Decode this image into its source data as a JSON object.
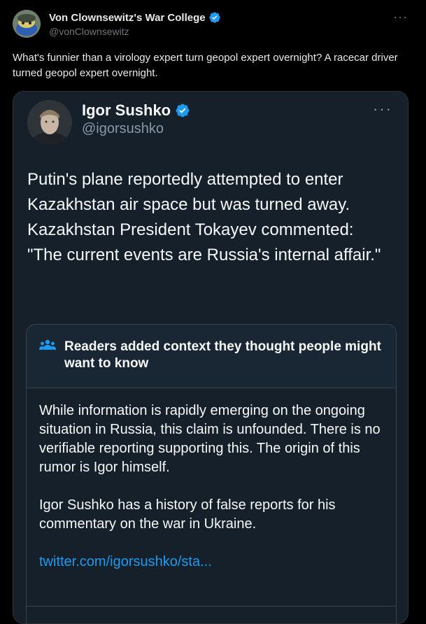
{
  "post": {
    "author_name": "Von Clownsewitz's War College",
    "author_handle": "@vonClownsewitz",
    "text": "What's funnier than a virology expert turn geopol expert overnight? A racecar driver turned geopol expert overnight.",
    "more_label": "···"
  },
  "quoted": {
    "author_name": "Igor Sushko",
    "author_handle": "@igorsushko",
    "more_label": "···",
    "text": "Putin's plane reportedly attempted to enter Kazakhstan air space but was turned away. Kazakhstan President Tokayev commented: \"The current events are Russia's internal affair.\"",
    "community_note": {
      "title": "Readers added context they thought people might want to know",
      "paragraph_1": "While information is rapidly emerging on the ongoing situation in Russia, this claim is unfounded. There is no verifiable reporting supporting this. The origin of this rumor is Igor himself.",
      "paragraph_2": "Igor Sushko has a history of false reports for his commentary on the war in Ukraine.",
      "link": "twitter.com/igorsushko/sta..."
    }
  },
  "colors": {
    "background": "#000000",
    "card": "#15202b",
    "accent": "#1d9bf0",
    "verified": "#1d9bf0"
  },
  "icons": [
    "verified-badge-icon",
    "more-icon",
    "community-notes-icon"
  ]
}
